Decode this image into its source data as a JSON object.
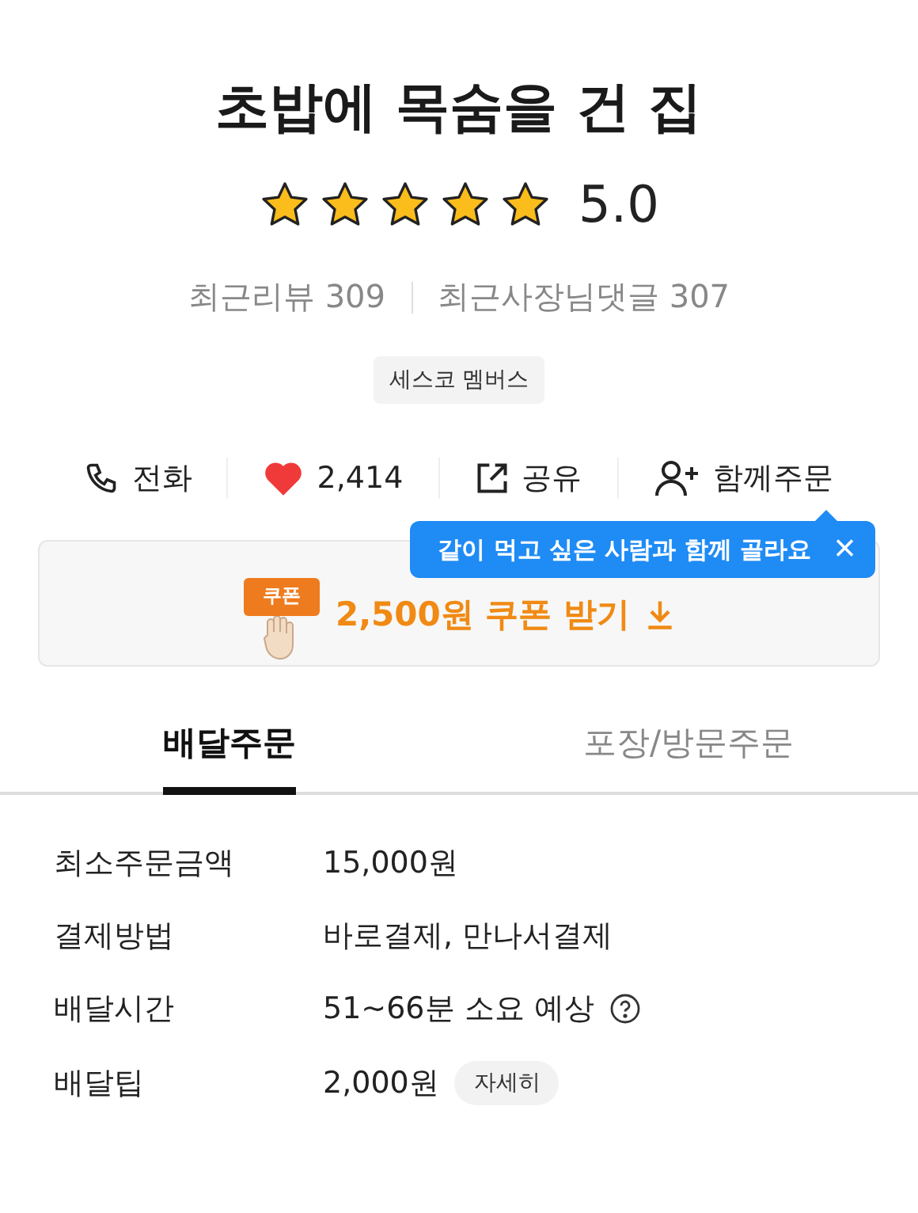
{
  "store": {
    "name": "초밥에 목숨을 건 집"
  },
  "rating": {
    "stars": 5,
    "score": "5.0"
  },
  "review_counts": [
    "최근리뷰 309",
    "최근사장님댓글 307"
  ],
  "badge": "세스코 멤버스",
  "actions": [
    {
      "kind": "phone",
      "label": "전화"
    },
    {
      "kind": "like",
      "label": "2,414"
    },
    {
      "kind": "share",
      "label": "공유"
    },
    {
      "kind": "group",
      "label": "함께주문"
    }
  ],
  "tooltip": {
    "text": "같이 먹고 싶은 사람과 함께 골라요",
    "close": "×"
  },
  "coupon": {
    "icon_text": "쿠폰",
    "label": "2,500원 쿠폰 받기"
  },
  "tabs": [
    {
      "label": "배달주문",
      "selected": true
    },
    {
      "label": "포장/방문주문",
      "selected": false
    }
  ],
  "info": [
    {
      "label": "최소주문금액",
      "value": "15,000원",
      "help": false
    },
    {
      "label": "결제방법",
      "value": "바로결제, 만나서결제",
      "help": false
    },
    {
      "label": "배달시간",
      "value": "51~66분 소요 예상",
      "help": true
    },
    {
      "label": "배달팁",
      "value": "2,000원",
      "help": false,
      "button": "자세히"
    }
  ]
}
